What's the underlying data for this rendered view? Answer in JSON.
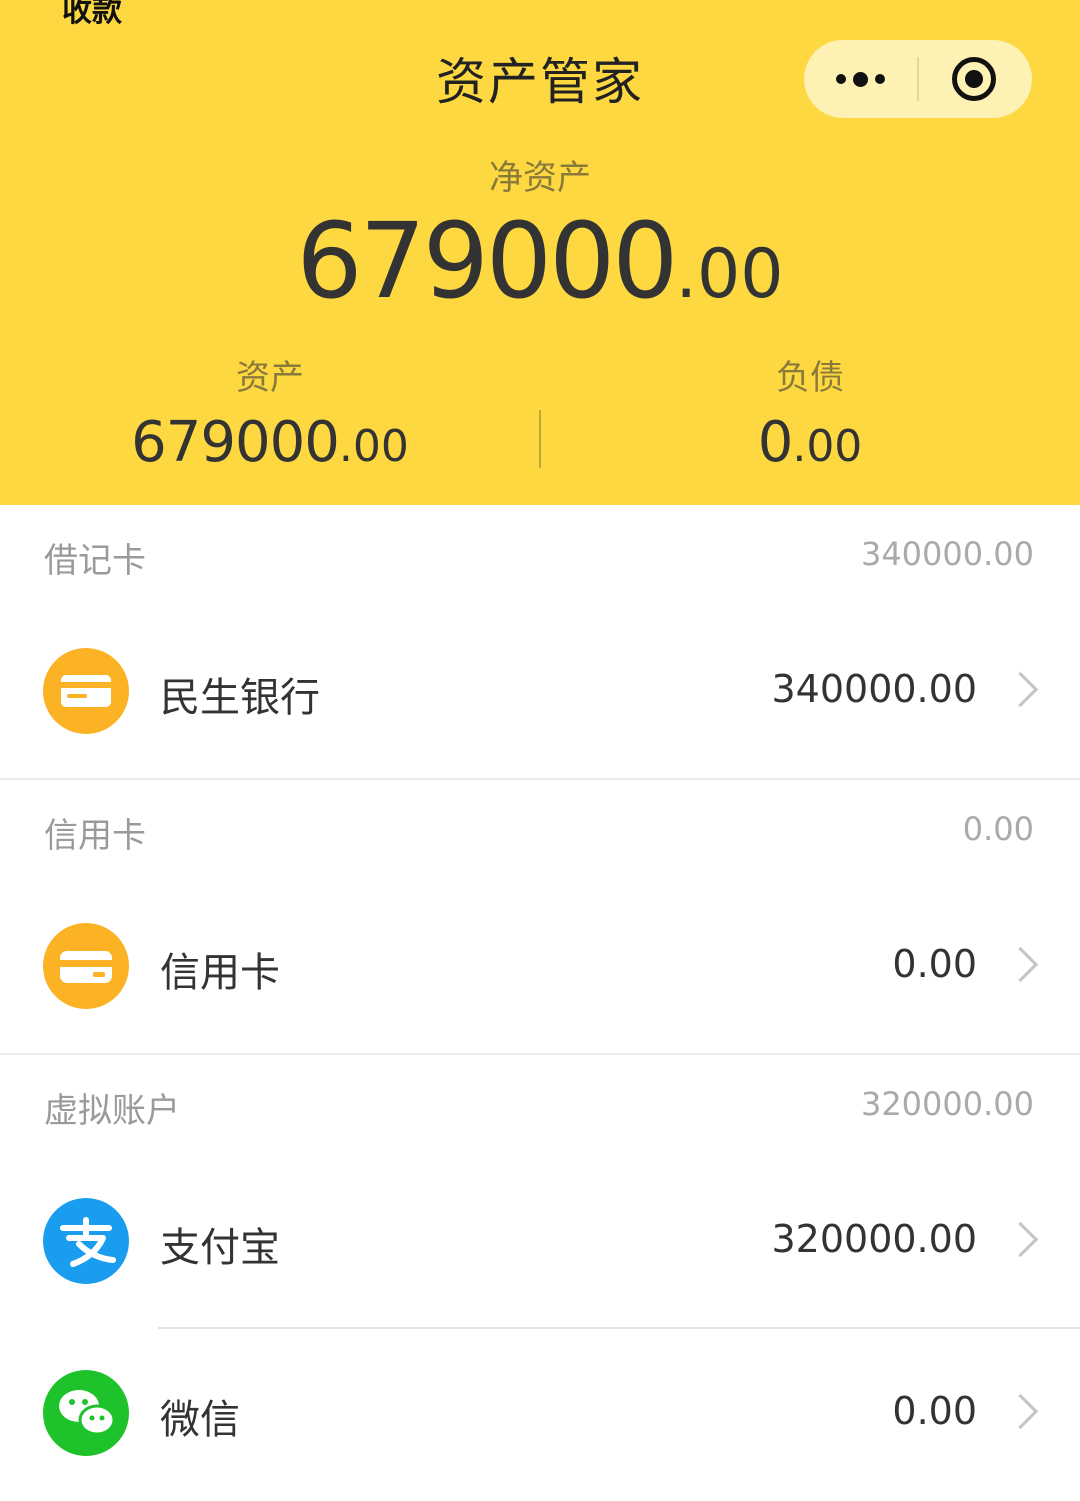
{
  "status_bar": {
    "partial_text": "收款"
  },
  "header": {
    "title": "资产管家",
    "net_label": "净资产",
    "net_int": "679000",
    "net_dec": ".00",
    "assets_label": "资产",
    "assets_int": "679000",
    "assets_dec": ".00",
    "liabilities_label": "负债",
    "liabilities_int": "0",
    "liabilities_dec": ".00",
    "background_color": "#fdd841"
  },
  "capsule": {
    "more_icon": "more-dots-icon",
    "close_icon": "target-circle-icon"
  },
  "sections": [
    {
      "name": "借记卡",
      "total": "340000.00",
      "items": [
        {
          "label": "民生银行",
          "amount": "340000.00",
          "icon": "bank-card-icon",
          "icon_color": "#fbb325"
        }
      ]
    },
    {
      "name": "信用卡",
      "total": "0.00",
      "items": [
        {
          "label": "信用卡",
          "amount": "0.00",
          "icon": "credit-card-icon",
          "icon_color": "#fbb325"
        }
      ]
    },
    {
      "name": "虚拟账户",
      "total": "320000.00",
      "items": [
        {
          "label": "支付宝",
          "amount": "320000.00",
          "icon": "alipay-icon",
          "icon_color": "#1a9dee"
        },
        {
          "label": "微信",
          "amount": "0.00",
          "icon": "wechat-icon",
          "icon_color": "#1ec22b"
        }
      ]
    }
  ]
}
